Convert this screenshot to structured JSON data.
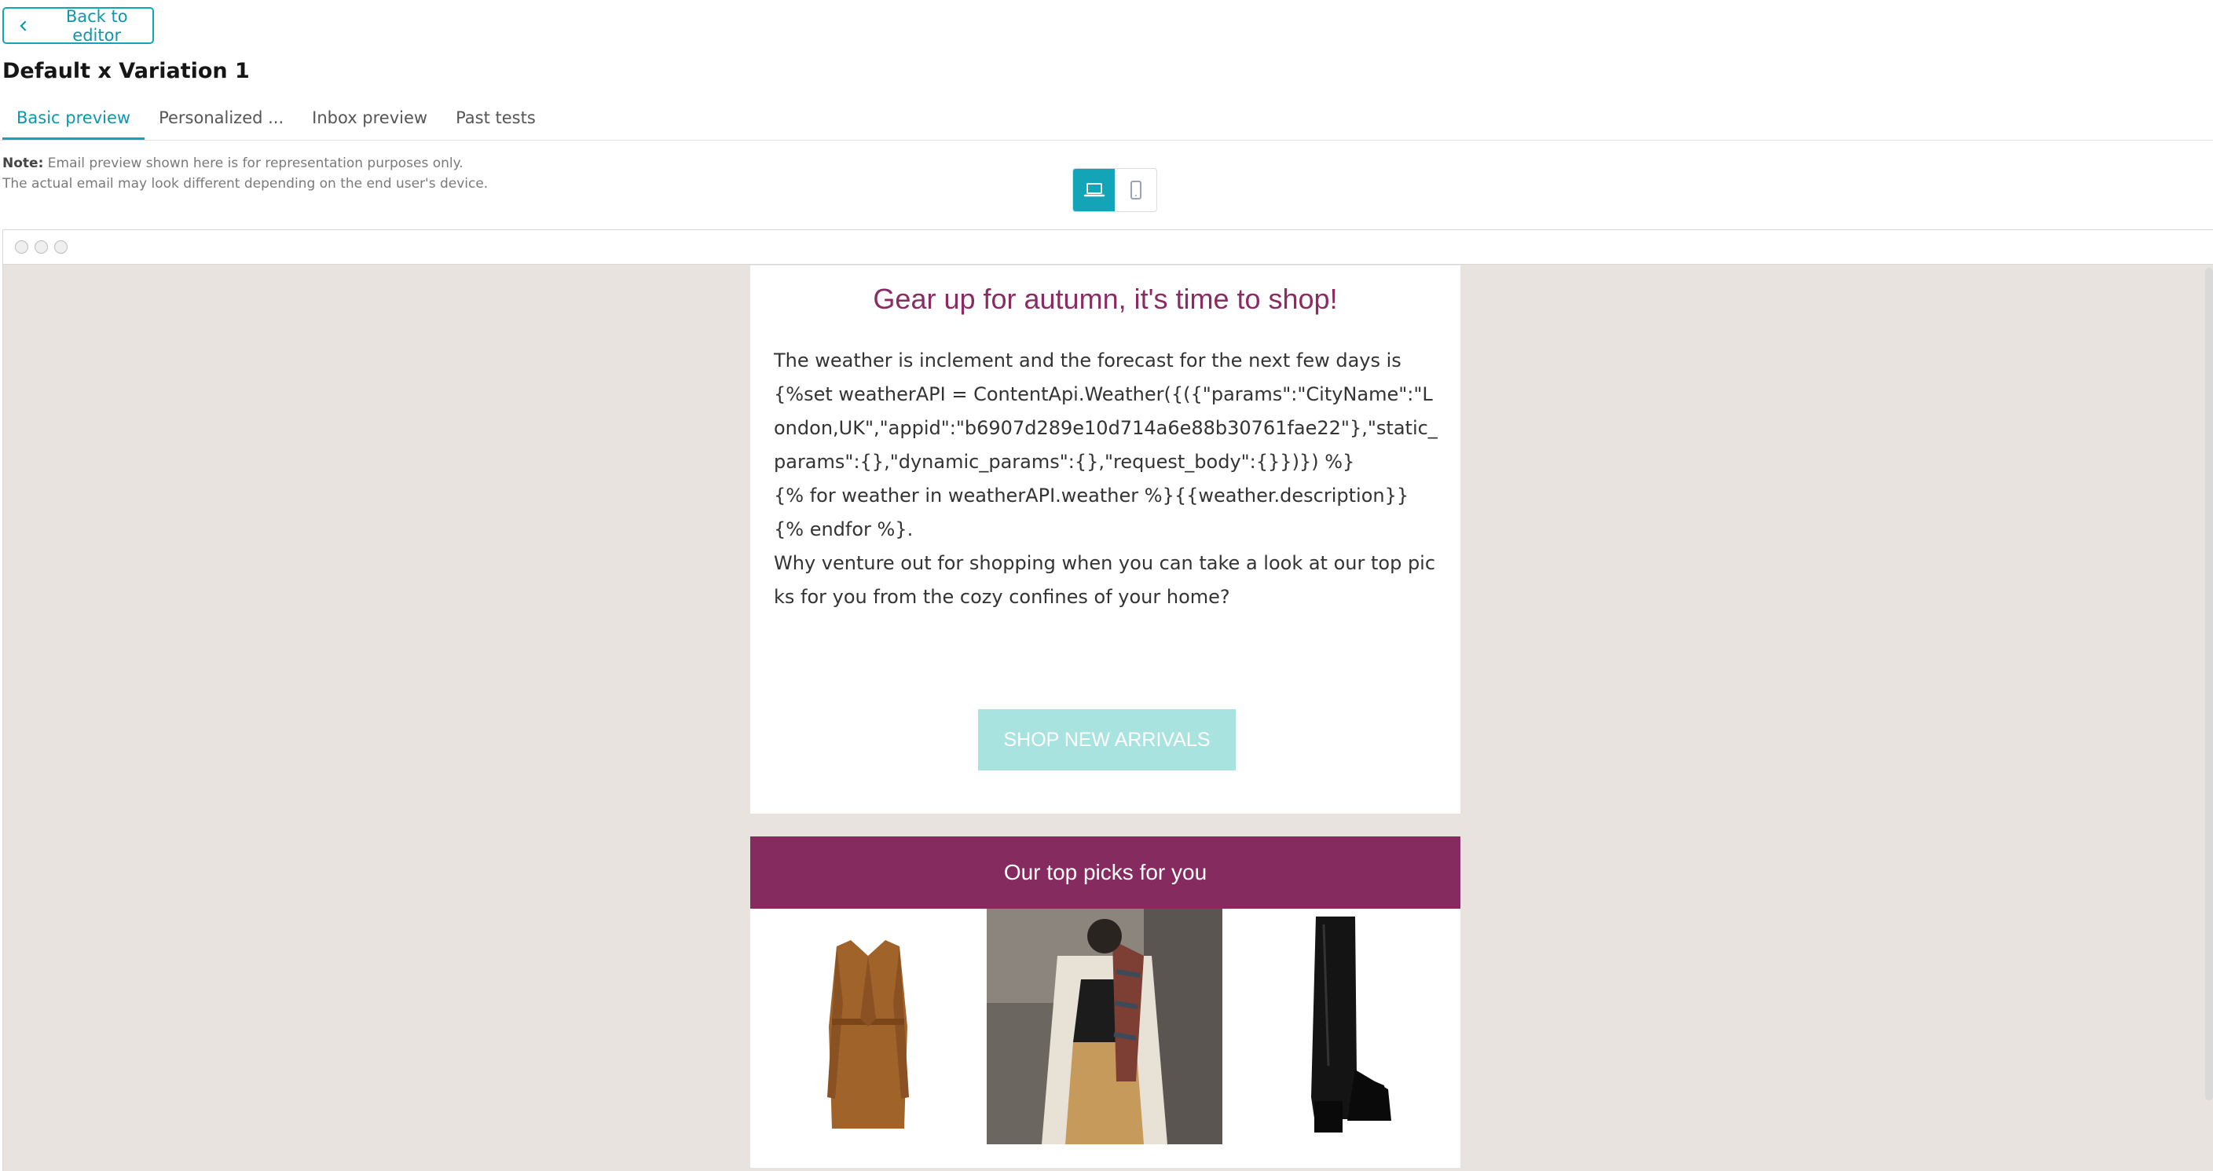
{
  "header": {
    "back_label": "Back to editor",
    "title": "Default x Variation 1"
  },
  "tabs": [
    {
      "label": "Basic preview",
      "active": true
    },
    {
      "label": "Personalized ..."
    },
    {
      "label": "Inbox preview"
    },
    {
      "label": "Past tests"
    }
  ],
  "note": {
    "label": "Note:",
    "line1": "Email preview shown here is for representation purposes only.",
    "line2": "The actual email may look different depending on the end user's device."
  },
  "device_toggle": {
    "selected": "desktop",
    "options": [
      "laptop-icon",
      "mobile-icon"
    ]
  },
  "email": {
    "heading": "Gear up for autumn, it's time to shop!",
    "body_line1": "The weather is inclement and the forecast for the next few days is",
    "body_code1": "{%set weatherAPI = ContentApi.Weather({({\"params\":\"CityName\":\"London,UK\",\"appid\":\"b6907d289e10d714a6e88b30761fae22\"},\"static_params\":{},\"dynamic_params\":{},\"request_body\":{}})}) %}",
    "body_code2": "{% for weather in weatherAPI.weather %}{{weather.description}} {% endfor %}.",
    "body_line3": "Why venture out for shopping when you can take a look at our top picks for you from the cozy confines of your home?",
    "cta_label": "SHOP NEW ARRIVALS",
    "picks_title": "Our top picks for you",
    "products": [
      "coat-image",
      "outfit-image",
      "boot-image"
    ]
  },
  "colors": {
    "accent": "#13a4b8",
    "brand": "#862b60",
    "cta": "#a9e3df",
    "canvas": "#e9e3df"
  }
}
